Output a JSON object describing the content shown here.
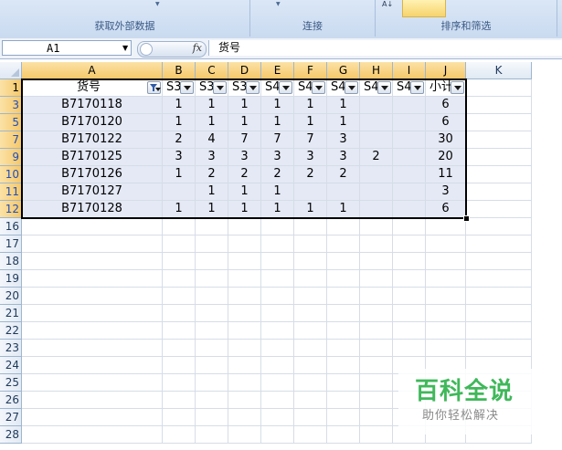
{
  "ribbon": {
    "groups": [
      {
        "label": "获取外部数据"
      },
      {
        "label": "连接"
      },
      {
        "label": "排序和筛选"
      }
    ]
  },
  "formula_bar": {
    "name_box": "A1",
    "fx_label": "fx",
    "content": "货号"
  },
  "grid": {
    "columns": [
      "A",
      "B",
      "C",
      "D",
      "E",
      "F",
      "G",
      "H",
      "I",
      "J",
      "K"
    ],
    "selected_columns": [
      "A",
      "B",
      "C",
      "D",
      "E",
      "F",
      "G",
      "H",
      "I",
      "J"
    ],
    "table_header": {
      "row": "1",
      "cells": [
        "货号",
        "S3",
        "S3",
        "S3",
        "S4",
        "S4",
        "S4",
        "S4",
        "S4",
        "小计"
      ]
    },
    "table_rows": [
      {
        "row": "3",
        "cells": [
          "B7170118",
          "1",
          "1",
          "1",
          "1",
          "1",
          "1",
          "",
          "",
          "6"
        ]
      },
      {
        "row": "5",
        "cells": [
          "B7170120",
          "1",
          "1",
          "1",
          "1",
          "1",
          "1",
          "",
          "",
          "6"
        ]
      },
      {
        "row": "7",
        "cells": [
          "B7170122",
          "2",
          "4",
          "7",
          "7",
          "7",
          "3",
          "",
          "",
          "30"
        ]
      },
      {
        "row": "9",
        "cells": [
          "B7170125",
          "3",
          "3",
          "3",
          "3",
          "3",
          "3",
          "2",
          "",
          "20"
        ]
      },
      {
        "row": "10",
        "cells": [
          "B7170126",
          "1",
          "2",
          "2",
          "2",
          "2",
          "2",
          "",
          "",
          "11"
        ]
      },
      {
        "row": "11",
        "cells": [
          "B7170127",
          "",
          "1",
          "1",
          "1",
          "",
          "",
          "",
          "",
          "3"
        ]
      },
      {
        "row": "12",
        "cells": [
          "B7170128",
          "1",
          "1",
          "1",
          "1",
          "1",
          "1",
          "",
          "",
          "6"
        ]
      }
    ],
    "empty_rows": [
      "16",
      "17",
      "18",
      "19",
      "20",
      "21",
      "22",
      "23",
      "24",
      "25",
      "26",
      "27",
      "28"
    ]
  },
  "watermark": {
    "title": "百科全说",
    "subtitle": "助你轻松解决"
  },
  "colors": {
    "table_fill": "#e4e9f5",
    "header_selected": "#f6c86a",
    "watermark_green": "#3fb85a"
  }
}
